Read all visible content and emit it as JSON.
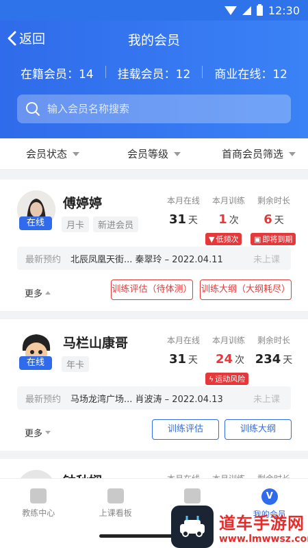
{
  "status": {
    "time": "12:30"
  },
  "header": {
    "back_label": "返回",
    "title": "我的会员",
    "stats": [
      {
        "label": "在籍会员：",
        "value": "14"
      },
      {
        "label": "挂载会员：",
        "value": "12"
      },
      {
        "label": "商业在线：",
        "value": "12"
      }
    ],
    "search_placeholder": "输入会员名称搜索"
  },
  "filters": [
    "会员状态",
    "会员等级",
    "首商会员筛选"
  ],
  "metric_labels": [
    "本月在线",
    "本月训练",
    "剩余时长"
  ],
  "booking_label": "最新预约",
  "more_label": "更多",
  "members": [
    {
      "status": "在线",
      "name": "傅婷婷",
      "tags": [
        "月卡",
        "新进会员"
      ],
      "online_days": "31",
      "online_unit": "天",
      "train_count": "1",
      "train_unit": "次",
      "remain": "6",
      "remain_unit": "天",
      "warnings": [
        "低频次",
        "即将到期"
      ],
      "booking": "北辰凤凰天街... 秦翠玲 – 2022.04.11",
      "booking_status": "未上课",
      "buttons": [
        "训练评估（待体测）",
        "训练大纲（大纲耗尽）"
      ]
    },
    {
      "status": "在线",
      "name": "马栏山康哥",
      "tags": [
        "年卡"
      ],
      "online_days": "31",
      "online_unit": "天",
      "train_count": "24",
      "train_unit": "次",
      "remain": "234",
      "remain_unit": "天",
      "warnings": [
        "运动风险"
      ],
      "booking": "马场龙湾广场... 肖波涛 – 2022.04.13",
      "booking_status": "未上课",
      "buttons": [
        "训练评估",
        "训练大纲"
      ]
    },
    {
      "name": "钟秋娴"
    }
  ],
  "tabs": [
    "教练中心",
    "上课看板",
    "",
    "我的会员"
  ],
  "watermark": {
    "title": "道车手游网",
    "url": "www.lmwwsz.com"
  },
  "colors": {
    "primary": "#2f6bea",
    "danger": "#e5383b"
  }
}
